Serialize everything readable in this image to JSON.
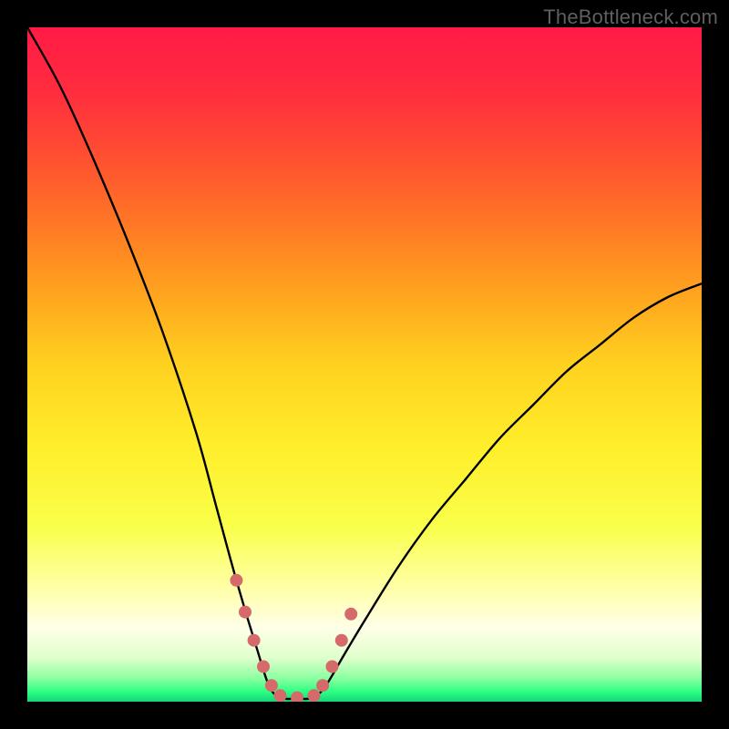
{
  "watermark": {
    "text": "TheBottleneck.com"
  },
  "gradient": {
    "stops": [
      {
        "offset": 0.0,
        "color": "#ff1a46"
      },
      {
        "offset": 0.1,
        "color": "#ff2e3e"
      },
      {
        "offset": 0.2,
        "color": "#ff5230"
      },
      {
        "offset": 0.3,
        "color": "#ff7b24"
      },
      {
        "offset": 0.4,
        "color": "#ffa61e"
      },
      {
        "offset": 0.5,
        "color": "#ffd120"
      },
      {
        "offset": 0.62,
        "color": "#ffee2a"
      },
      {
        "offset": 0.74,
        "color": "#f9ff4a"
      },
      {
        "offset": 0.83,
        "color": "#ffffa6"
      },
      {
        "offset": 0.89,
        "color": "#ffffe8"
      },
      {
        "offset": 0.935,
        "color": "#e0ffcc"
      },
      {
        "offset": 0.965,
        "color": "#8dffa0"
      },
      {
        "offset": 0.985,
        "color": "#2eff84"
      },
      {
        "offset": 1.0,
        "color": "#13d67a"
      }
    ]
  },
  "chart_data": {
    "type": "line",
    "title": "",
    "xlabel": "",
    "ylabel": "",
    "xlim": [
      0,
      100
    ],
    "ylim": [
      0,
      100
    ],
    "y_axis_inverted_visually": true,
    "note": "Bottleneck-style curve: x is relative hardware balance, y is bottleneck percentage. Minimum (~0%) near x≈36–43; rises steeply toward x=0 (~100%) and more gradually toward x=100 (~62%).",
    "series": [
      {
        "name": "bottleneck-curve",
        "x": [
          0,
          5,
          10,
          15,
          20,
          25,
          28,
          31,
          34,
          36,
          38,
          40,
          42,
          44,
          47,
          50,
          55,
          60,
          65,
          70,
          75,
          80,
          85,
          90,
          95,
          100
        ],
        "y": [
          100,
          91,
          80,
          68,
          55,
          40,
          29,
          18,
          8,
          2,
          0.5,
          0.5,
          0.5,
          2,
          7,
          12,
          20,
          27,
          33,
          39,
          44,
          49,
          53,
          57,
          60,
          62
        ]
      }
    ],
    "markers": {
      "name": "dotted-valley-highlight",
      "color": "#d66a6a",
      "radius_px": 7,
      "points_xy": [
        [
          31.0,
          18.0
        ],
        [
          32.3,
          13.3
        ],
        [
          33.6,
          9.1
        ],
        [
          35.0,
          5.2
        ],
        [
          36.2,
          2.4
        ],
        [
          37.5,
          0.9
        ],
        [
          40.0,
          0.6
        ],
        [
          42.5,
          0.9
        ],
        [
          43.8,
          2.4
        ],
        [
          45.2,
          5.2
        ],
        [
          46.6,
          9.1
        ],
        [
          48.0,
          13.0
        ]
      ]
    }
  }
}
